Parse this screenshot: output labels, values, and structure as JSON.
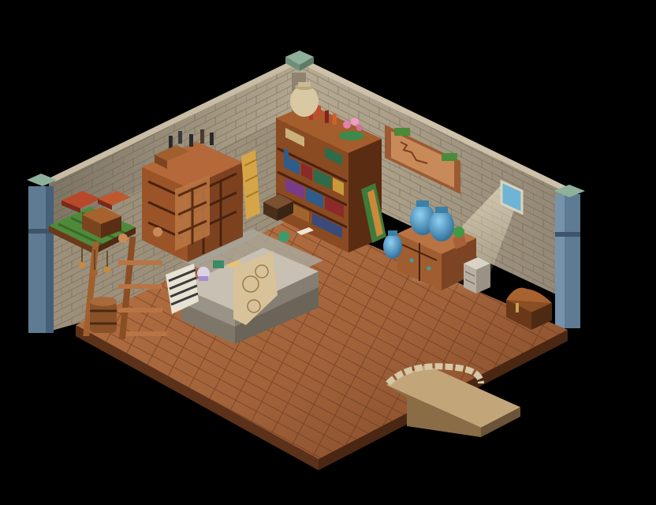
{
  "scene": {
    "kind": "isometric-room",
    "palette": {
      "background": "#000000",
      "floor_wood": "#a7653a",
      "floor_wood_dark": "#7a4424",
      "wall_stone": "#a69a86",
      "wall_stone_dark": "#6f6656",
      "pillar_blue": "#5f7a93",
      "pillar_cap": "#8fb09a",
      "bookcase_wood": "#7a3e1c",
      "jar_blue": "#4a8fb8",
      "counter_stone": "#b7b0a4",
      "light_beam": "#fff6d8"
    }
  }
}
